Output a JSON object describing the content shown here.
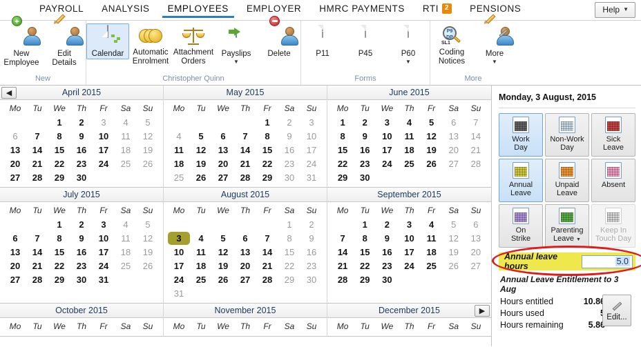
{
  "topnav": {
    "items": [
      {
        "label": "PAYROLL",
        "active": false
      },
      {
        "label": "ANALYSIS",
        "active": false
      },
      {
        "label": "EMPLOYEES",
        "active": true
      },
      {
        "label": "EMPLOYER",
        "active": false
      },
      {
        "label": "HMRC PAYMENTS",
        "active": false
      },
      {
        "label": "RTI",
        "active": false,
        "badge": "2"
      },
      {
        "label": "PENSIONS",
        "active": false
      }
    ],
    "help_label": "Help",
    "help_caret": "▼",
    "badge_color": "#e8890c",
    "active_underline_color": "#2b7cc9"
  },
  "ribbon": {
    "groups": [
      {
        "label": "New",
        "buttons": [
          {
            "label": "New\nEmployee",
            "icon": "new-employee-icon",
            "selected": false,
            "dropdown": false
          },
          {
            "label": "Edit\nDetails",
            "icon": "edit-details-icon",
            "selected": false,
            "dropdown": false
          }
        ]
      },
      {
        "label": "Christopher Quinn",
        "buttons": [
          {
            "label": "Calendar",
            "icon": "calendar-icon",
            "selected": true,
            "dropdown": false
          },
          {
            "label": "Automatic\nEnrolment",
            "icon": "automatic-enrolment-icon",
            "selected": false,
            "dropdown": false
          },
          {
            "label": "Attachment\nOrders",
            "icon": "attachment-orders-icon",
            "selected": false,
            "dropdown": false
          },
          {
            "label": "Payslips",
            "icon": "payslips-icon",
            "selected": false,
            "dropdown": true
          },
          {
            "label": "Delete",
            "icon": "delete-employee-icon",
            "selected": false,
            "dropdown": false
          }
        ]
      },
      {
        "label": "Forms",
        "buttons": [
          {
            "label": "P11",
            "icon": "p11-form-icon",
            "tag": "P11",
            "tag_color": "#d8a20a",
            "selected": false,
            "dropdown": false
          },
          {
            "label": "P45",
            "icon": "p45-form-icon",
            "tag": "P45",
            "tag_color": "#b22222",
            "selected": false,
            "dropdown": false
          },
          {
            "label": "P60",
            "icon": "p60-form-icon",
            "tag": "P60",
            "tag_color": "#1f5fa8",
            "selected": false,
            "dropdown": true
          }
        ]
      },
      {
        "label": "More",
        "buttons": [
          {
            "label": "Coding\nNotices",
            "icon": "coding-notices-icon",
            "selected": false,
            "dropdown": false
          },
          {
            "label": "More",
            "icon": "more-tools-icon",
            "selected": false,
            "dropdown": true
          }
        ]
      }
    ]
  },
  "calendar": {
    "prev_arrow": "◀",
    "next_arrow": "▶",
    "dow": [
      "Mo",
      "Tu",
      "We",
      "Th",
      "Fr",
      "Sa",
      "Su"
    ],
    "selected_color": "#a5a02e",
    "months": [
      {
        "title": "April 2015",
        "lead_blanks": 2,
        "days": [
          {
            "n": "1"
          },
          {
            "n": "2"
          },
          {
            "n": "3",
            "off": true
          },
          {
            "n": "4",
            "off": true
          },
          {
            "n": "5",
            "off": true
          },
          {
            "n": "6",
            "off": true
          },
          {
            "n": "7"
          },
          {
            "n": "8"
          },
          {
            "n": "9"
          },
          {
            "n": "10"
          },
          {
            "n": "11",
            "off": true
          },
          {
            "n": "12",
            "off": true
          },
          {
            "n": "13"
          },
          {
            "n": "14"
          },
          {
            "n": "15"
          },
          {
            "n": "16"
          },
          {
            "n": "17"
          },
          {
            "n": "18",
            "off": true
          },
          {
            "n": "19",
            "off": true
          },
          {
            "n": "20"
          },
          {
            "n": "21"
          },
          {
            "n": "22"
          },
          {
            "n": "23"
          },
          {
            "n": "24"
          },
          {
            "n": "25",
            "off": true
          },
          {
            "n": "26",
            "off": true
          },
          {
            "n": "27"
          },
          {
            "n": "28"
          },
          {
            "n": "29"
          },
          {
            "n": "30"
          }
        ]
      },
      {
        "title": "May 2015",
        "lead_blanks": 4,
        "days": [
          {
            "n": "1"
          },
          {
            "n": "2",
            "off": true
          },
          {
            "n": "3",
            "off": true
          },
          {
            "n": "4",
            "off": true
          },
          {
            "n": "5"
          },
          {
            "n": "6"
          },
          {
            "n": "7"
          },
          {
            "n": "8"
          },
          {
            "n": "9",
            "off": true
          },
          {
            "n": "10",
            "off": true
          },
          {
            "n": "11"
          },
          {
            "n": "12"
          },
          {
            "n": "13"
          },
          {
            "n": "14"
          },
          {
            "n": "15"
          },
          {
            "n": "16",
            "off": true
          },
          {
            "n": "17",
            "off": true
          },
          {
            "n": "18"
          },
          {
            "n": "19"
          },
          {
            "n": "20"
          },
          {
            "n": "21"
          },
          {
            "n": "22"
          },
          {
            "n": "23",
            "off": true
          },
          {
            "n": "24",
            "off": true
          },
          {
            "n": "25",
            "off": true
          },
          {
            "n": "26"
          },
          {
            "n": "27"
          },
          {
            "n": "28"
          },
          {
            "n": "29"
          },
          {
            "n": "30",
            "off": true
          },
          {
            "n": "31",
            "off": true
          }
        ]
      },
      {
        "title": "June 2015",
        "lead_blanks": 0,
        "days": [
          {
            "n": "1"
          },
          {
            "n": "2"
          },
          {
            "n": "3"
          },
          {
            "n": "4"
          },
          {
            "n": "5"
          },
          {
            "n": "6",
            "off": true
          },
          {
            "n": "7",
            "off": true
          },
          {
            "n": "8"
          },
          {
            "n": "9"
          },
          {
            "n": "10"
          },
          {
            "n": "11"
          },
          {
            "n": "12"
          },
          {
            "n": "13",
            "off": true
          },
          {
            "n": "14",
            "off": true
          },
          {
            "n": "15"
          },
          {
            "n": "16"
          },
          {
            "n": "17"
          },
          {
            "n": "18"
          },
          {
            "n": "19"
          },
          {
            "n": "20",
            "off": true
          },
          {
            "n": "21",
            "off": true
          },
          {
            "n": "22"
          },
          {
            "n": "23"
          },
          {
            "n": "24"
          },
          {
            "n": "25"
          },
          {
            "n": "26"
          },
          {
            "n": "27",
            "off": true
          },
          {
            "n": "28",
            "off": true
          },
          {
            "n": "29"
          },
          {
            "n": "30"
          }
        ]
      },
      {
        "title": "July 2015",
        "lead_blanks": 2,
        "days": [
          {
            "n": "1"
          },
          {
            "n": "2"
          },
          {
            "n": "3"
          },
          {
            "n": "4",
            "off": true
          },
          {
            "n": "5",
            "off": true
          },
          {
            "n": "6"
          },
          {
            "n": "7"
          },
          {
            "n": "8"
          },
          {
            "n": "9"
          },
          {
            "n": "10"
          },
          {
            "n": "11",
            "off": true
          },
          {
            "n": "12",
            "off": true
          },
          {
            "n": "13"
          },
          {
            "n": "14"
          },
          {
            "n": "15"
          },
          {
            "n": "16"
          },
          {
            "n": "17"
          },
          {
            "n": "18",
            "off": true
          },
          {
            "n": "19",
            "off": true
          },
          {
            "n": "20"
          },
          {
            "n": "21"
          },
          {
            "n": "22"
          },
          {
            "n": "23"
          },
          {
            "n": "24"
          },
          {
            "n": "25",
            "off": true
          },
          {
            "n": "26",
            "off": true
          },
          {
            "n": "27"
          },
          {
            "n": "28"
          },
          {
            "n": "29"
          },
          {
            "n": "30"
          },
          {
            "n": "31"
          }
        ]
      },
      {
        "title": "August 2015",
        "lead_blanks": 5,
        "days": [
          {
            "n": "1",
            "off": true
          },
          {
            "n": "2",
            "off": true
          },
          {
            "n": "3",
            "sel": true
          },
          {
            "n": "4"
          },
          {
            "n": "5"
          },
          {
            "n": "6"
          },
          {
            "n": "7"
          },
          {
            "n": "8",
            "off": true
          },
          {
            "n": "9",
            "off": true
          },
          {
            "n": "10"
          },
          {
            "n": "11"
          },
          {
            "n": "12"
          },
          {
            "n": "13"
          },
          {
            "n": "14"
          },
          {
            "n": "15",
            "off": true
          },
          {
            "n": "16",
            "off": true
          },
          {
            "n": "17"
          },
          {
            "n": "18"
          },
          {
            "n": "19"
          },
          {
            "n": "20"
          },
          {
            "n": "21"
          },
          {
            "n": "22",
            "off": true
          },
          {
            "n": "23",
            "off": true
          },
          {
            "n": "24"
          },
          {
            "n": "25"
          },
          {
            "n": "26"
          },
          {
            "n": "27"
          },
          {
            "n": "28"
          },
          {
            "n": "29",
            "off": true
          },
          {
            "n": "30",
            "off": true
          },
          {
            "n": "31",
            "off": true
          }
        ]
      },
      {
        "title": "September 2015",
        "lead_blanks": 1,
        "days": [
          {
            "n": "1"
          },
          {
            "n": "2"
          },
          {
            "n": "3"
          },
          {
            "n": "4"
          },
          {
            "n": "5",
            "off": true
          },
          {
            "n": "6",
            "off": true
          },
          {
            "n": "7"
          },
          {
            "n": "8"
          },
          {
            "n": "9"
          },
          {
            "n": "10"
          },
          {
            "n": "11"
          },
          {
            "n": "12",
            "off": true
          },
          {
            "n": "13",
            "off": true
          },
          {
            "n": "14"
          },
          {
            "n": "15"
          },
          {
            "n": "16"
          },
          {
            "n": "17"
          },
          {
            "n": "18"
          },
          {
            "n": "19",
            "off": true
          },
          {
            "n": "20",
            "off": true
          },
          {
            "n": "21"
          },
          {
            "n": "22"
          },
          {
            "n": "23"
          },
          {
            "n": "24"
          },
          {
            "n": "25"
          },
          {
            "n": "26",
            "off": true
          },
          {
            "n": "27",
            "off": true
          },
          {
            "n": "28"
          },
          {
            "n": "29"
          },
          {
            "n": "30"
          }
        ]
      },
      {
        "title": "October 2015",
        "lead_blanks": 0,
        "days": []
      },
      {
        "title": "November 2015",
        "lead_blanks": 0,
        "days": []
      },
      {
        "title": "December 2015",
        "lead_blanks": 0,
        "days": []
      }
    ]
  },
  "sidebar": {
    "date": "Monday, 3 August, 2015",
    "tiles": [
      {
        "label": "Work\nDay",
        "icon": "work-day-icon",
        "state": "on",
        "pattern": "#4a4a4a"
      },
      {
        "label": "Non-Work\nDay",
        "icon": "non-work-day-icon",
        "state": "off",
        "pattern": "#c3d8e8"
      },
      {
        "label": "Sick\nLeave",
        "icon": "sick-leave-icon",
        "state": "off",
        "pattern": "#c02626"
      },
      {
        "label": "Annual\nLeave",
        "icon": "annual-leave-icon",
        "state": "on",
        "pattern": "#cfc41f"
      },
      {
        "label": "Unpaid\nLeave",
        "icon": "unpaid-leave-icon",
        "state": "off",
        "pattern": "#ef8a18"
      },
      {
        "label": "Absent",
        "icon": "absent-icon",
        "state": "off",
        "pattern": "#f08fbb"
      },
      {
        "label": "On\nStrike",
        "icon": "on-strike-icon",
        "state": "off",
        "pattern": "#a182d8"
      },
      {
        "label": "Parenting\nLeave",
        "icon": "parenting-leave-icon",
        "state": "off",
        "pattern": "#3fa32a",
        "dropdown": true
      },
      {
        "label": "Keep In\nTouch Day",
        "icon": "keep-in-touch-day-icon",
        "state": "disabled",
        "pattern": "#d8d8d8"
      }
    ],
    "annual_leave_hours_label": "Annual leave hours",
    "annual_leave_hours_value": "5.0",
    "highlight_color": "#efe84c",
    "annotation_color": "#e01b1b",
    "entitlement_title": "Annual Leave Entitlement to 3 Aug",
    "stats": [
      {
        "key": "Hours entitled",
        "value": "10.86"
      },
      {
        "key": "Hours used",
        "value": "5"
      },
      {
        "key": "Hours remaining",
        "value": "5.86"
      }
    ],
    "edit_label": "Edit..."
  }
}
